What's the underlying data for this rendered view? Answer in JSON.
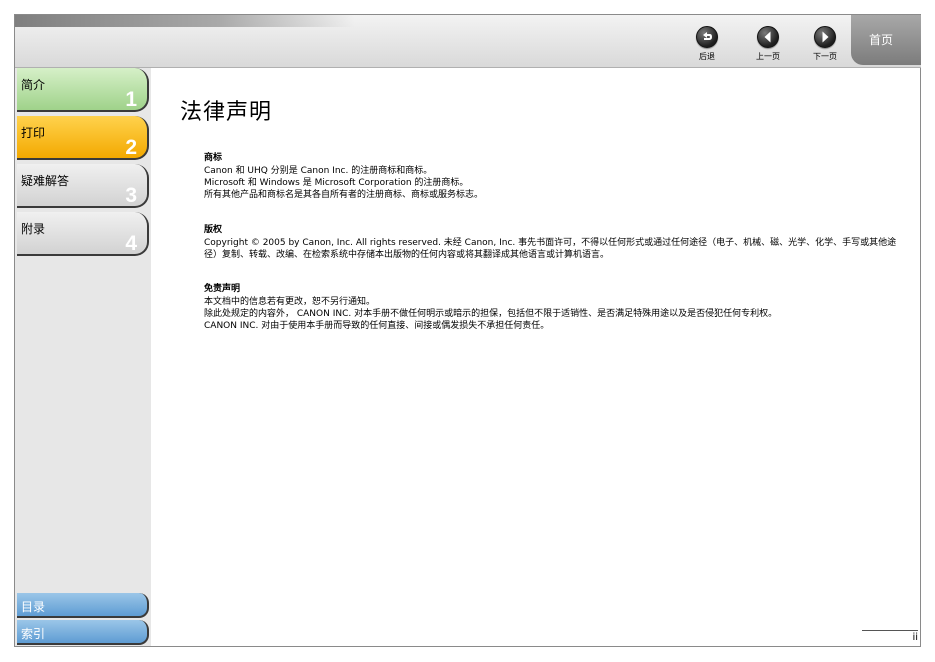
{
  "header": {
    "nav": {
      "back_label": "后退",
      "prev_label": "上一页",
      "next_label": "下一页"
    },
    "home_label": "首页"
  },
  "sidebar": {
    "chapters": [
      {
        "label": "简介",
        "num": "1"
      },
      {
        "label": "打印",
        "num": "2"
      },
      {
        "label": "疑难解答",
        "num": "3"
      },
      {
        "label": "附录",
        "num": "4"
      }
    ],
    "bottom": [
      {
        "label": "目录"
      },
      {
        "label": "索引"
      }
    ]
  },
  "content": {
    "title": "法律声明",
    "sections": [
      {
        "heading": "商标",
        "lines": [
          "Canon 和 UHQ 分别是 Canon Inc. 的注册商标和商标。",
          "Microsoft 和 Windows 是 Microsoft Corporation 的注册商标。",
          "所有其他产品和商标名是其各自所有者的注册商标、商标或服务标志。"
        ]
      },
      {
        "heading": "版权",
        "lines": [
          "Copyright © 2005 by Canon, Inc. All rights reserved. 未经 Canon, Inc. 事先书面许可，不得以任何形式或通过任何途径（电子、机械、磁、光学、化学、手写或其他途径）复制、转载、改编、在检索系统中存储本出版物的任何内容或将其翻译成其他语言或计算机语言。"
        ]
      },
      {
        "heading": "免责声明",
        "lines": [
          "本文档中的信息若有更改，恕不另行通知。",
          "除此处规定的内容外， CANON INC. 对本手册不做任何明示或暗示的担保，包括但不限于适销性、是否满足特殊用途以及是否侵犯任何专利权。",
          "CANON INC. 对由于使用本手册而导致的任何直接、间接或偶发损失不承担任何责任。"
        ]
      }
    ]
  },
  "footer": {
    "page_number": "ii"
  }
}
